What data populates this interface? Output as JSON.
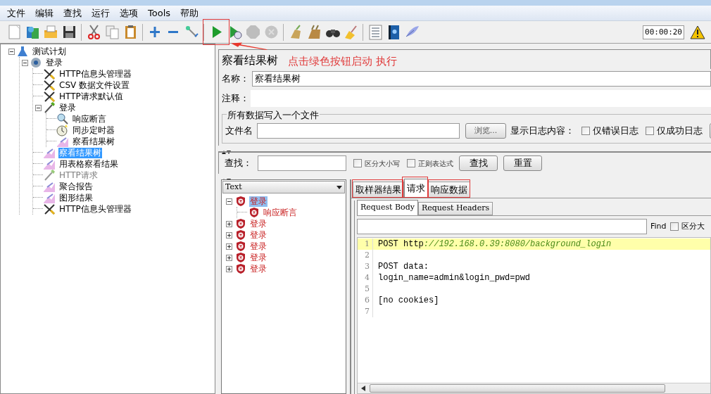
{
  "menu": [
    {
      "label": "文件"
    },
    {
      "label": "编辑"
    },
    {
      "label": "查找"
    },
    {
      "label": "运行"
    },
    {
      "label": "选项"
    },
    {
      "label": "Tools"
    },
    {
      "label": "帮助"
    }
  ],
  "toolbar": [
    {
      "kind": "new",
      "disabled": false
    },
    {
      "kind": "templates",
      "disabled": false
    },
    {
      "kind": "open",
      "disabled": false
    },
    {
      "kind": "save",
      "disabled": false
    },
    {
      "kind": "separator"
    },
    {
      "kind": "cut",
      "disabled": false
    },
    {
      "kind": "copy",
      "disabled": false
    },
    {
      "kind": "paste",
      "disabled": false
    },
    {
      "kind": "separator"
    },
    {
      "kind": "add",
      "disabled": false
    },
    {
      "kind": "remove",
      "disabled": false
    },
    {
      "kind": "toggle",
      "disabled": false
    },
    {
      "kind": "separator"
    },
    {
      "kind": "start",
      "disabled": false
    },
    {
      "kind": "start_no_timers",
      "disabled": false
    },
    {
      "kind": "stop",
      "disabled": true
    },
    {
      "kind": "shutdown",
      "disabled": true
    },
    {
      "kind": "separator"
    },
    {
      "kind": "clear",
      "disabled": false
    },
    {
      "kind": "clear_all",
      "disabled": false
    },
    {
      "kind": "search",
      "disabled": false
    },
    {
      "kind": "reset_search",
      "disabled": false
    },
    {
      "kind": "separator"
    },
    {
      "kind": "function_helper",
      "disabled": false
    },
    {
      "kind": "help",
      "disabled": false
    },
    {
      "kind": "logo",
      "disabled": false
    }
  ],
  "timer": "00:00:20",
  "annotation": "点击绿色按钮启动 执行",
  "tree": [
    {
      "label": "测试计划",
      "kind": "plan",
      "expanded": true,
      "selected": false,
      "disabled": false,
      "children": [
        {
          "label": "登录",
          "kind": "thread_group",
          "expanded": true,
          "selected": false,
          "disabled": false,
          "children": [
            {
              "label": "HTTP信息头管理器",
              "kind": "config",
              "selected": false,
              "disabled": false
            },
            {
              "label": "CSV 数据文件设置",
              "kind": "config",
              "selected": false,
              "disabled": false
            },
            {
              "label": "HTTP请求默认值",
              "kind": "config",
              "selected": false,
              "disabled": false
            },
            {
              "label": "登录",
              "kind": "sampler",
              "expanded": true,
              "selected": false,
              "disabled": false,
              "children": [
                {
                  "label": "响应断言",
                  "kind": "assertion",
                  "selected": false,
                  "disabled": false
                },
                {
                  "label": "同步定时器",
                  "kind": "timer",
                  "selected": false,
                  "disabled": false
                },
                {
                  "label": "察看结果树",
                  "kind": "listener",
                  "selected": false,
                  "disabled": false
                }
              ]
            },
            {
              "label": "察看结果树",
              "kind": "listener",
              "selected": true,
              "disabled": false
            },
            {
              "label": "用表格察看结果",
              "kind": "listener",
              "selected": false,
              "disabled": false
            },
            {
              "label": "HTTP请求",
              "kind": "sampler",
              "selected": false,
              "disabled": true
            },
            {
              "label": "聚合报告",
              "kind": "listener",
              "selected": false,
              "disabled": false
            },
            {
              "label": "图形结果",
              "kind": "listener",
              "selected": false,
              "disabled": false
            },
            {
              "label": "HTTP信息头管理器",
              "kind": "config",
              "selected": false,
              "disabled": false
            }
          ]
        }
      ]
    }
  ],
  "panel": {
    "title": "察看结果树",
    "name_label": "名称：",
    "name_value": "察看结果树",
    "comment_label": "注释：",
    "file_group": {
      "legend": "所有数据写入一个文件",
      "filename_label": "文件名",
      "browse_button": "浏览...",
      "log_label": "显示日志内容：",
      "options": [
        {
          "label": "仅错误日志",
          "checked": false
        },
        {
          "label": "仅成功日志",
          "checked": false
        }
      ]
    },
    "search": {
      "label": "查找：",
      "options": [
        {
          "label": "区分大小写",
          "checked": false
        },
        {
          "label": "正则表达式",
          "checked": false
        }
      ],
      "buttons": [
        {
          "label": "查找"
        },
        {
          "label": "重置"
        }
      ]
    },
    "renderer": "Text",
    "results": [
      {
        "label": "登录",
        "failed": true,
        "expanded": true,
        "selected": true,
        "children": [
          {
            "label": "响应断言",
            "failed": true,
            "selected": false
          }
        ]
      },
      {
        "label": "登录",
        "failed": true,
        "expanded": false,
        "selected": false
      },
      {
        "label": "登录",
        "failed": true,
        "expanded": false,
        "selected": false
      },
      {
        "label": "登录",
        "failed": true,
        "expanded": false,
        "selected": false
      },
      {
        "label": "登录",
        "failed": true,
        "expanded": false,
        "selected": false
      },
      {
        "label": "登录",
        "failed": true,
        "expanded": false,
        "selected": false
      }
    ],
    "tabs": [
      {
        "label": "取样器结果",
        "selected": false
      },
      {
        "label": "请求",
        "selected": true
      },
      {
        "label": "响应数据",
        "selected": false
      }
    ],
    "subtabs": [
      {
        "label": "Request Body",
        "selected": true
      },
      {
        "label": "Request Headers",
        "selected": false
      }
    ],
    "find": {
      "label": "Find",
      "options": [
        {
          "label": "区分大",
          "checked": false
        }
      ]
    },
    "code_lines": [
      {
        "number": "1",
        "text": "POST http",
        "link": "://192.168.0.39:8080/background_login",
        "highlighted": true
      },
      {
        "number": "2",
        "highlighted": false
      },
      {
        "number": "3",
        "text": "POST data:",
        "highlighted": false
      },
      {
        "number": "4",
        "text": "login_name=admin&login_pwd=pwd",
        "highlighted": false
      },
      {
        "number": "5",
        "highlighted": false
      },
      {
        "number": "6",
        "text": "[no cookies]",
        "highlighted": false
      },
      {
        "number": "7",
        "highlighted": false
      }
    ]
  }
}
